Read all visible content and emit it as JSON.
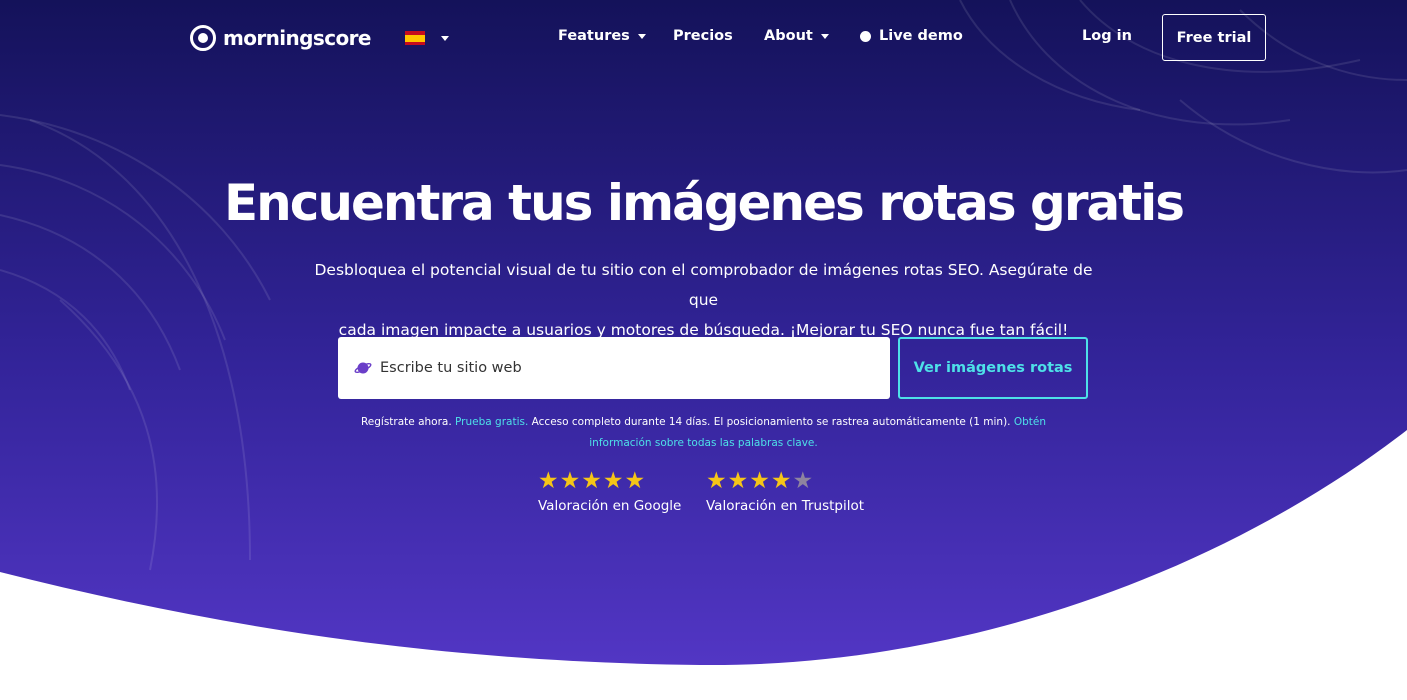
{
  "brand": {
    "name": "morningscore"
  },
  "language": {
    "flag": "es-flag"
  },
  "nav": {
    "features": "Features",
    "precios": "Precios",
    "about": "About",
    "live_demo": "Live demo",
    "login": "Log in",
    "free_trial": "Free trial"
  },
  "hero": {
    "title": "Encuentra tus imágenes rotas gratis",
    "subtitle_line1": "Desbloquea el potencial visual de tu sitio con el comprobador de imágenes rotas SEO. Asegúrate de que",
    "subtitle_line2": "cada imagen impacte a usuarios y motores de búsqueda. ¡Mejorar tu SEO nunca fue tan fácil!"
  },
  "search": {
    "placeholder": "Escribe tu sitio web",
    "button": "Ver imágenes rotas",
    "icon": "planet-icon"
  },
  "fine_print": {
    "part1": "Regístrate ahora. ",
    "link1": "Prueba gratis.",
    "part2": " Acceso completo durante 14 días. El posicionamiento se rastrea automáticamente (1 min). ",
    "link2": "Obtén información sobre todas las palabras clave."
  },
  "ratings": [
    {
      "label": "Valoración en Google",
      "stars": 5,
      "max": 5
    },
    {
      "label": "Valoración en Trustpilot",
      "stars": 4,
      "max": 5
    }
  ],
  "colors": {
    "hero_top": "#14125a",
    "hero_bottom": "#5236c4",
    "accent": "#4ee0e8",
    "star": "#f5c518"
  }
}
